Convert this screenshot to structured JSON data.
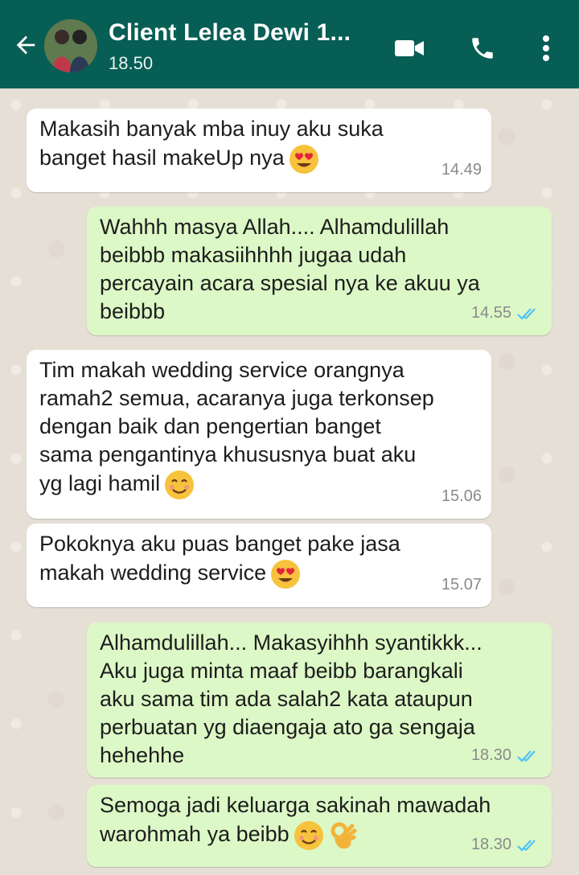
{
  "header": {
    "title": "Client Lelea Dewi 1...",
    "subtitle": "18.50",
    "icons": [
      "back-arrow-icon",
      "video-call-icon",
      "phone-icon",
      "more-vert-icon"
    ]
  },
  "messages": [
    {
      "direction": "incoming",
      "text": "Makasih banyak mba inuy aku suka\nbanget hasil makeUp nya",
      "emoji": "heart-eyes",
      "time": "14.49"
    },
    {
      "direction": "outgoing",
      "text": "Wahhh masya Allah.... Alhamdulillah\nbeibbb makasiihhhh jugaa udah\npercayain acara spesial nya ke akuu ya\nbeibbb",
      "time": "14.55",
      "status": "read"
    },
    {
      "direction": "incoming",
      "text": "Tim makah wedding service orangnya\nramah2 semua, acaranya juga terkonsep\ndengan baik dan pengertian banget\nsama pengantinya khususnya buat aku\nyg lagi hamil",
      "emoji": "smiling",
      "time": "15.06"
    },
    {
      "direction": "incoming",
      "text": "Pokoknya aku puas banget pake jasa\nmakah wedding service",
      "emoji": "heart-eyes",
      "time": "15.07"
    },
    {
      "direction": "outgoing",
      "text": "Alhamdulillah... Makasyihhh syantikkk...\nAku juga minta maaf beibb barangkali\naku sama tim ada salah2 kata ataupun\nperbuatan yg diaengaja ato ga sengaja\nhehehhe",
      "time": "18.30",
      "status": "read"
    },
    {
      "direction": "outgoing",
      "text": "Semoga jadi keluarga sakinah mawadah\nwarohmah ya beibb",
      "emoji": "smiling-ok",
      "time": "18.30",
      "status": "read"
    }
  ],
  "colors": {
    "appbar": "#075e54",
    "incoming_bubble": "#ffffff",
    "outgoing_bubble": "#dcf8c6",
    "read_ticks": "#4fc3f7",
    "wallpaper": "#e6dfd6"
  }
}
